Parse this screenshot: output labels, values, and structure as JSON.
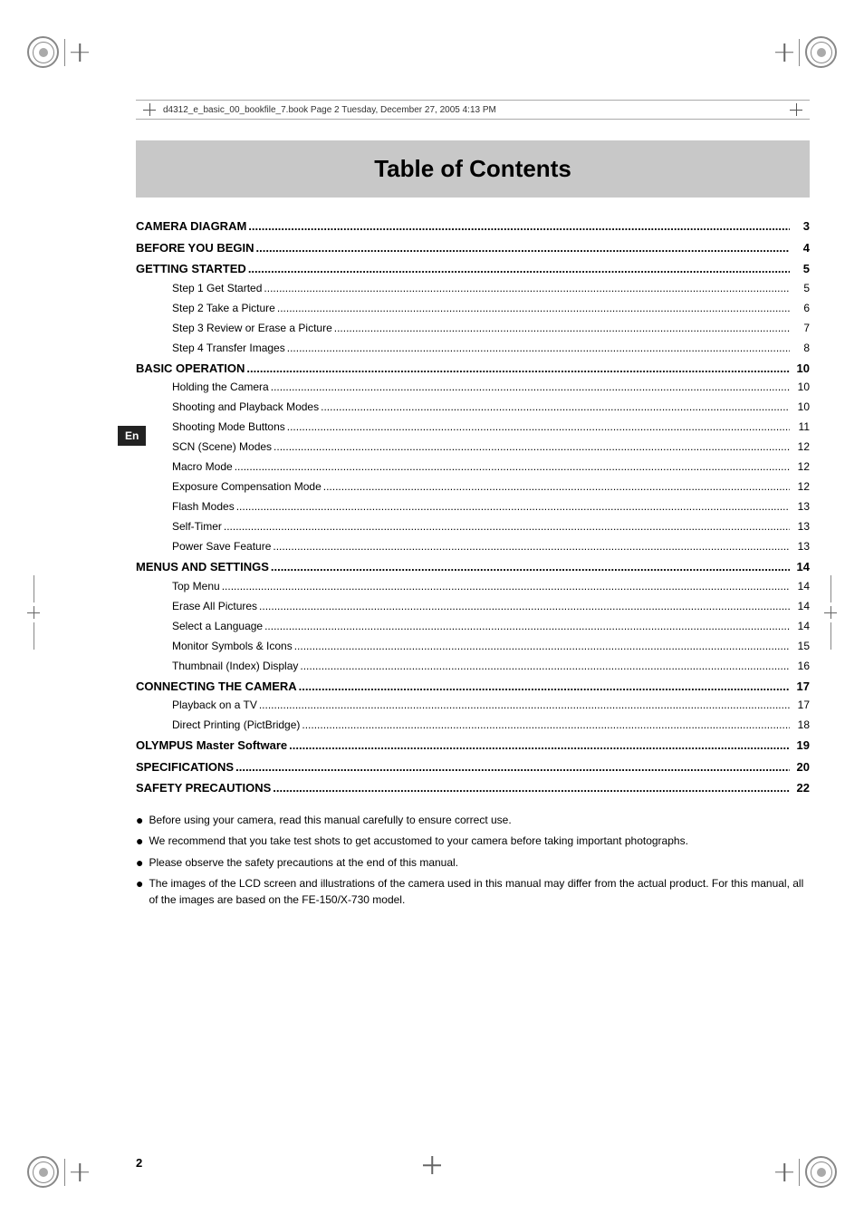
{
  "page": {
    "title": "Table of Contents",
    "file_info": "d4312_e_basic_00_bookfile_7.book  Page 2  Tuesday, December 27, 2005  4:13 PM",
    "page_number": "2",
    "lang_tag": "En"
  },
  "toc": {
    "sections": [
      {
        "id": "camera-diagram",
        "label": "CAMERA DIAGRAM",
        "page": "3",
        "type": "main",
        "subsections": []
      },
      {
        "id": "before-you-begin",
        "label": "BEFORE YOU BEGIN",
        "page": "4",
        "type": "main",
        "subsections": []
      },
      {
        "id": "getting-started",
        "label": "GETTING STARTED",
        "page": "5",
        "type": "main",
        "subsections": [
          {
            "label": "Step 1 Get Started",
            "page": "5"
          },
          {
            "label": "Step 2 Take a Picture",
            "page": "6"
          },
          {
            "label": "Step 3 Review or Erase a Picture",
            "page": "7"
          },
          {
            "label": "Step 4 Transfer Images",
            "page": "8"
          }
        ]
      },
      {
        "id": "basic-operation",
        "label": "BASIC OPERATION",
        "page": "10",
        "type": "main",
        "subsections": [
          {
            "label": "Holding the Camera",
            "page": "10"
          },
          {
            "label": "Shooting and Playback Modes",
            "page": "10"
          },
          {
            "label": "Shooting Mode Buttons",
            "page": "11"
          },
          {
            "label": "SCN (Scene) Modes",
            "page": "12"
          },
          {
            "label": "Macro Mode",
            "page": "12"
          },
          {
            "label": "Exposure Compensation Mode",
            "page": "12"
          },
          {
            "label": "Flash Modes",
            "page": "13"
          },
          {
            "label": "Self-Timer",
            "page": "13"
          },
          {
            "label": "Power Save Feature",
            "page": "13"
          }
        ]
      },
      {
        "id": "menus-settings",
        "label": "MENUS AND SETTINGS",
        "page": "14",
        "type": "main",
        "subsections": [
          {
            "label": "Top Menu",
            "page": "14"
          },
          {
            "label": "Erase All Pictures",
            "page": "14"
          },
          {
            "label": "Select a Language",
            "page": "14"
          },
          {
            "label": "Monitor Symbols & Icons",
            "page": "15"
          },
          {
            "label": "Thumbnail (Index) Display",
            "page": "16"
          }
        ]
      },
      {
        "id": "connecting-camera",
        "label": "CONNECTING THE CAMERA",
        "page": "17",
        "type": "main",
        "subsections": [
          {
            "label": "Playback on a TV",
            "page": "17"
          },
          {
            "label": "Direct Printing (PictBridge)",
            "page": "18"
          }
        ]
      },
      {
        "id": "olympus-master",
        "label": "OLYMPUS Master Software",
        "page": "19",
        "type": "main",
        "subsections": []
      },
      {
        "id": "specifications",
        "label": "SPECIFICATIONS",
        "page": "20",
        "type": "main",
        "subsections": []
      },
      {
        "id": "safety-precautions",
        "label": "SAFETY PRECAUTIONS",
        "page": "22",
        "type": "main",
        "subsections": []
      }
    ]
  },
  "notes": [
    "Before using your camera, read this manual carefully to ensure correct use.",
    "We recommend that you take test shots to get accustomed to your camera before taking important photographs.",
    "Please observe the safety precautions at the end of this manual.",
    "The images of the LCD screen and illustrations of the camera used in this manual may differ from the actual product. For this manual, all of the images are based on the FE-150/X-730 model."
  ]
}
